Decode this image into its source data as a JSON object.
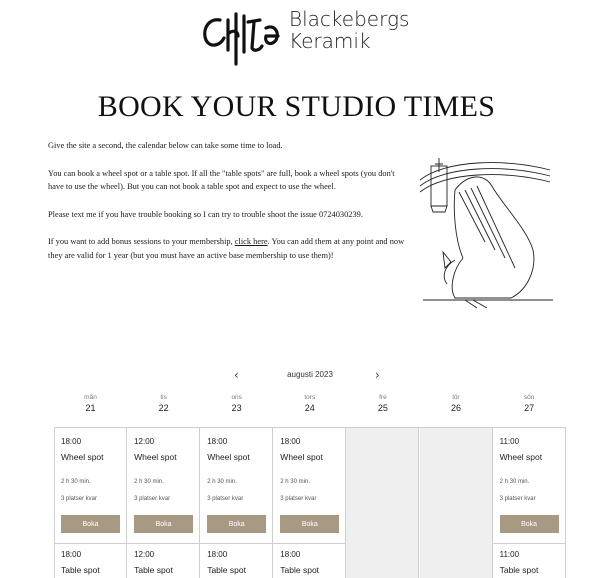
{
  "brand": {
    "line1": "Blackebergs",
    "line2": "Keramik"
  },
  "page_title": "BOOK YOUR STUDIO TIMES",
  "intro": {
    "p1": "Give the site a second, the calendar below can take some time to load.",
    "p2": "You can book a wheel spot or a table spot. If all the \"table spots\" are full, book a wheel spots (you don't have to use the wheel). But you can not book a table spot and expect to use the wheel.",
    "p3": "Please text me if you have trouble booking so I can try to trouble shoot the issue 0724030239.",
    "p4_before": "If you want to add bonus sessions to your membership, ",
    "p4_link": "click here",
    "p4_after": ". You can add them at any point and now they are valid for 1 year (but you must have an active base membership to use them)!"
  },
  "calendar": {
    "month": "augusti 2023",
    "prev_icon": "chevron-left-icon",
    "next_icon": "chevron-right-icon",
    "days": [
      {
        "name": "mån",
        "date": "21"
      },
      {
        "name": "tis",
        "date": "22"
      },
      {
        "name": "ons",
        "date": "23"
      },
      {
        "name": "tors",
        "date": "24"
      },
      {
        "name": "fre",
        "date": "25"
      },
      {
        "name": "lör",
        "date": "26"
      },
      {
        "name": "sön",
        "date": "27"
      }
    ],
    "slots": [
      {
        "time": "18:00",
        "service": "Wheel spot",
        "duration": "2 h 30 min.",
        "spots": "3 platser kvar",
        "book": "Boka",
        "time2": "18:00",
        "service2": "Table spot"
      },
      {
        "time": "12:00",
        "service": "Wheel spot",
        "duration": "2 h 30 min.",
        "spots": "3 platser kvar",
        "book": "Boka",
        "time2": "12:00",
        "service2": "Table spot"
      },
      {
        "time": "18:00",
        "service": "Wheel spot",
        "duration": "2 h 30 min.",
        "spots": "3 platser kvar",
        "book": "Boka",
        "time2": "18:00",
        "service2": "Table spot"
      },
      {
        "time": "18:00",
        "service": "Wheel spot",
        "duration": "2 h 30 min.",
        "spots": "3 platser kvar",
        "book": "Boka",
        "time2": "18:00",
        "service2": "Table spot"
      },
      null,
      null,
      {
        "time": "11:00",
        "service": "Wheel spot",
        "duration": "2 h 30 min.",
        "spots": "3 platser kvar",
        "book": "Boka",
        "time2": "11:00",
        "service2": "Table spot"
      }
    ]
  },
  "colors": {
    "button": "#a89a82",
    "empty_day": "#efefef",
    "border": "#cfcfcf"
  }
}
